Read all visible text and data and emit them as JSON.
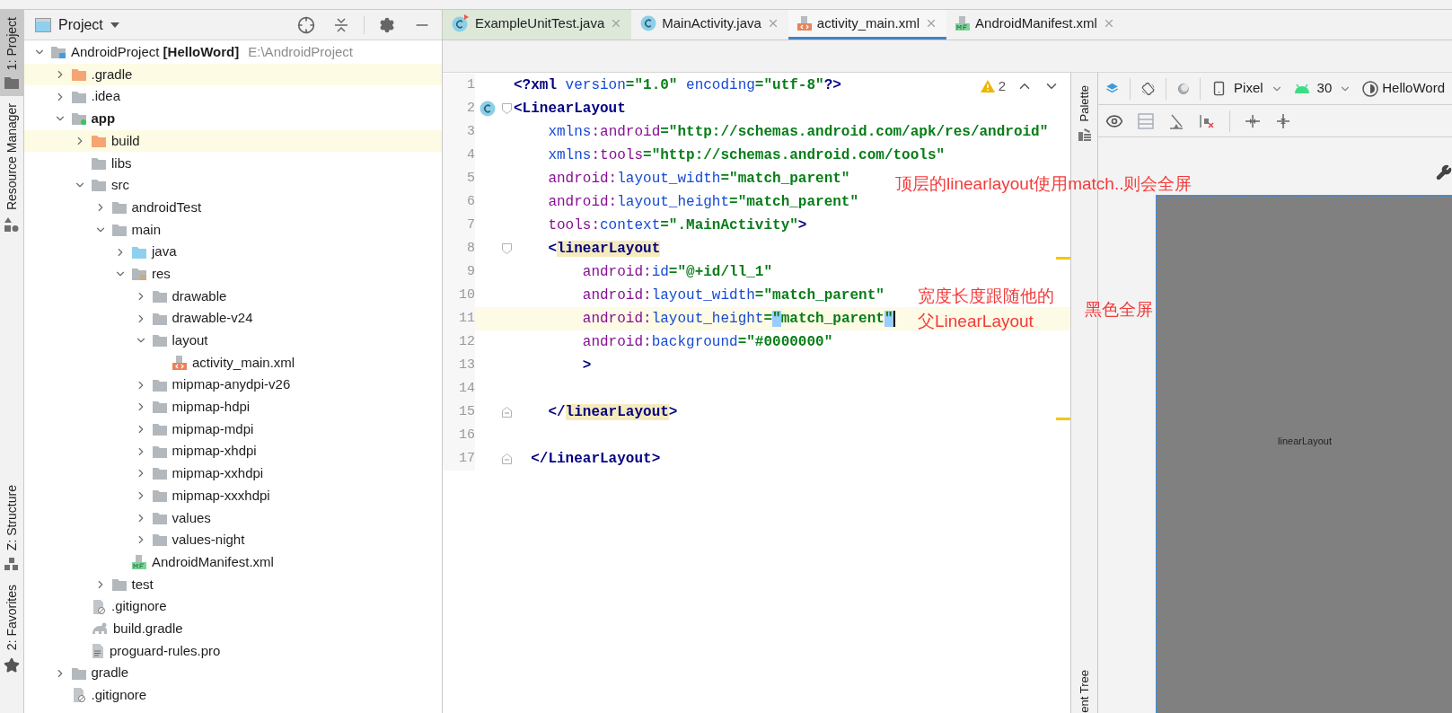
{
  "tool_bar_left": {
    "top": [
      {
        "label": "1: Project",
        "selected": true
      },
      {
        "label": "Resource Manager",
        "selected": false
      }
    ],
    "bottom": [
      {
        "label": "Z: Structure",
        "selected": false
      },
      {
        "label": "2: Favorites",
        "selected": false
      }
    ]
  },
  "project_panel": {
    "title": "Project",
    "tree": [
      {
        "label": "AndroidProject **[HelloWord]**",
        "path": "E:\\AndroidProject",
        "kind": "project",
        "expanded": true,
        "highlighted": false,
        "children": [
          {
            "label": ".gradle",
            "kind": "excluded-folder",
            "expanded": false,
            "highlighted": true
          },
          {
            "label": ".idea",
            "kind": "folder",
            "expanded": false,
            "highlighted": false
          },
          {
            "label": "app",
            "kind": "module",
            "expanded": true,
            "highlighted": false,
            "children": [
              {
                "label": "build",
                "kind": "excluded-folder",
                "expanded": false,
                "highlighted": true
              },
              {
                "label": "libs",
                "kind": "folder",
                "highlighted": false
              },
              {
                "label": "src",
                "kind": "folder",
                "expanded": true,
                "highlighted": false,
                "children": [
                  {
                    "label": "androidTest",
                    "kind": "folder",
                    "expanded": false,
                    "highlighted": false
                  },
                  {
                    "label": "main",
                    "kind": "folder",
                    "expanded": true,
                    "highlighted": false,
                    "children": [
                      {
                        "label": "java",
                        "kind": "source-folder",
                        "expanded": false,
                        "highlighted": false
                      },
                      {
                        "label": "res",
                        "kind": "res-folder",
                        "expanded": true,
                        "highlighted": false,
                        "children": [
                          {
                            "label": "drawable",
                            "kind": "folder",
                            "expanded": false,
                            "highlighted": false
                          },
                          {
                            "label": "drawable-v24",
                            "kind": "folder",
                            "expanded": false,
                            "highlighted": false
                          },
                          {
                            "label": "layout",
                            "kind": "folder",
                            "expanded": true,
                            "highlighted": false,
                            "children": [
                              {
                                "label": "activity_main.xml",
                                "kind": "xml-file",
                                "highlighted": false
                              }
                            ]
                          },
                          {
                            "label": "mipmap-anydpi-v26",
                            "kind": "folder",
                            "expanded": false,
                            "highlighted": false
                          },
                          {
                            "label": "mipmap-hdpi",
                            "kind": "folder",
                            "expanded": false,
                            "highlighted": false
                          },
                          {
                            "label": "mipmap-mdpi",
                            "kind": "folder",
                            "expanded": false,
                            "highlighted": false
                          },
                          {
                            "label": "mipmap-xhdpi",
                            "kind": "folder",
                            "expanded": false,
                            "highlighted": false
                          },
                          {
                            "label": "mipmap-xxhdpi",
                            "kind": "folder",
                            "expanded": false,
                            "highlighted": false
                          },
                          {
                            "label": "mipmap-xxxhdpi",
                            "kind": "folder",
                            "expanded": false,
                            "highlighted": false
                          },
                          {
                            "label": "values",
                            "kind": "folder",
                            "expanded": false,
                            "highlighted": false
                          },
                          {
                            "label": "values-night",
                            "kind": "folder",
                            "expanded": false,
                            "highlighted": false
                          }
                        ]
                      },
                      {
                        "label": "AndroidManifest.xml",
                        "kind": "manifest-file",
                        "highlighted": false
                      }
                    ]
                  },
                  {
                    "label": "test",
                    "kind": "folder",
                    "expanded": false,
                    "highlighted": false
                  }
                ]
              },
              {
                "label": ".gitignore",
                "kind": "ignore-file",
                "highlighted": false
              },
              {
                "label": "build.gradle",
                "kind": "gradle-file",
                "highlighted": false
              },
              {
                "label": "proguard-rules.pro",
                "kind": "text-file",
                "highlighted": false
              }
            ]
          },
          {
            "label": "gradle",
            "kind": "folder",
            "expanded": false,
            "highlighted": false
          },
          {
            "label": ".gitignore",
            "kind": "ignore-file",
            "highlighted": false
          }
        ]
      }
    ]
  },
  "editor": {
    "tabs": [
      {
        "label": "ExampleUnitTest.java",
        "kind": "test-class",
        "selected": false
      },
      {
        "label": "MainActivity.java",
        "kind": "class",
        "selected": false
      },
      {
        "label": "activity_main.xml",
        "kind": "xml",
        "selected": true
      },
      {
        "label": "AndroidManifest.xml",
        "kind": "manifest",
        "selected": false
      }
    ],
    "inspection": {
      "count": "2"
    },
    "lines": [
      {
        "number": "1",
        "current": false,
        "tokens": [
          {
            "kind": "tag",
            "text": "<?xml "
          },
          {
            "kind": "attr",
            "text": "version"
          },
          {
            "kind": "value",
            "text": "=\"1.0\" "
          },
          {
            "kind": "attr",
            "text": "encoding"
          },
          {
            "kind": "value",
            "text": "=\"utf-8\""
          },
          {
            "kind": "tag",
            "text": "?>"
          }
        ]
      },
      {
        "number": "2",
        "current": false,
        "markers": [
          {
            "kind": "class"
          },
          {
            "kind": "fold-open"
          }
        ],
        "tokens": [
          {
            "kind": "tag",
            "text": "<LinearLayout"
          }
        ]
      },
      {
        "number": "3",
        "current": false,
        "tokens": [
          {
            "kind": "attr",
            "text": "    xmlns"
          },
          {
            "kind": "ns",
            "text": ":android"
          },
          {
            "kind": "value",
            "text": "=\"http://schemas.android.com/apk/res/android\""
          }
        ]
      },
      {
        "number": "4",
        "current": false,
        "tokens": [
          {
            "kind": "attr",
            "text": "    xmlns"
          },
          {
            "kind": "ns",
            "text": ":tools"
          },
          {
            "kind": "value",
            "text": "=\"http://schemas.android.com/tools\""
          }
        ]
      },
      {
        "number": "5",
        "current": false,
        "tokens": [
          {
            "kind": "ns",
            "text": "    android:"
          },
          {
            "kind": "attr",
            "text": "layout_width"
          },
          {
            "kind": "value",
            "text": "=\"match_parent\""
          }
        ]
      },
      {
        "number": "6",
        "current": false,
        "tokens": [
          {
            "kind": "ns",
            "text": "    android:"
          },
          {
            "kind": "attr",
            "text": "layout_height"
          },
          {
            "kind": "value",
            "text": "=\"match_parent\""
          }
        ]
      },
      {
        "number": "7",
        "current": false,
        "tokens": [
          {
            "kind": "ns",
            "text": "    tools:"
          },
          {
            "kind": "attr",
            "text": "context"
          },
          {
            "kind": "value",
            "text": "=\".MainActivity\""
          },
          {
            "kind": "tag",
            "text": ">"
          }
        ]
      },
      {
        "number": "8",
        "current": false,
        "markers": [
          {
            "kind": "fold-open"
          }
        ],
        "tokens": [
          {
            "kind": "tag",
            "text": "    <"
          },
          {
            "kind": "tag-match",
            "text": "linearLayout"
          }
        ]
      },
      {
        "number": "9",
        "current": false,
        "tokens": [
          {
            "kind": "ns",
            "text": "        android:"
          },
          {
            "kind": "attr",
            "text": "id"
          },
          {
            "kind": "value",
            "text": "=\"@+id/ll_1\""
          }
        ]
      },
      {
        "number": "10",
        "current": false,
        "tokens": [
          {
            "kind": "ns",
            "text": "        android:"
          },
          {
            "kind": "attr",
            "text": "layout_width"
          },
          {
            "kind": "value",
            "text": "=\"match_parent\""
          }
        ]
      },
      {
        "number": "11",
        "current": true,
        "tokens": [
          {
            "kind": "ns",
            "text": "        android:"
          },
          {
            "kind": "attr",
            "text": "layout_height"
          },
          {
            "kind": "value",
            "text": "="
          },
          {
            "kind": "quote-match",
            "text": "\""
          },
          {
            "kind": "value",
            "text": "match_parent"
          },
          {
            "kind": "quote-match",
            "text": "\""
          }
        ]
      },
      {
        "number": "12",
        "current": false,
        "tokens": [
          {
            "kind": "ns",
            "text": "        android:"
          },
          {
            "kind": "attr",
            "text": "background"
          },
          {
            "kind": "value",
            "text": "=\"#0000000\""
          }
        ]
      },
      {
        "number": "13",
        "current": false,
        "tokens": [
          {
            "kind": "tag",
            "text": "        >"
          }
        ]
      },
      {
        "number": "14",
        "current": false
      },
      {
        "number": "15",
        "current": false,
        "markers": [
          {
            "kind": "fold-close"
          }
        ],
        "tokens": [
          {
            "kind": "tag",
            "text": "    </"
          },
          {
            "kind": "tag-match",
            "text": "linearLayout"
          },
          {
            "kind": "tag",
            "text": ">"
          }
        ]
      },
      {
        "number": "16",
        "current": false
      },
      {
        "number": "17",
        "current": false,
        "markers": [
          {
            "kind": "fold-close"
          }
        ],
        "tokens": [
          {
            "kind": "tag",
            "text": "  </LinearLayout>"
          }
        ]
      }
    ]
  },
  "side_strip": {
    "top": "Palette",
    "bottom": "ent Tree"
  },
  "design": {
    "device": "Pixel",
    "api": "30",
    "theme": "HelloWord",
    "canvas_label": "linearLayout"
  },
  "annotations": [
    "顶层的linearlayout使用match..则会全屏",
    "宽度长度跟随他的",
    "父LinearLayout",
    "黑色全屏"
  ]
}
